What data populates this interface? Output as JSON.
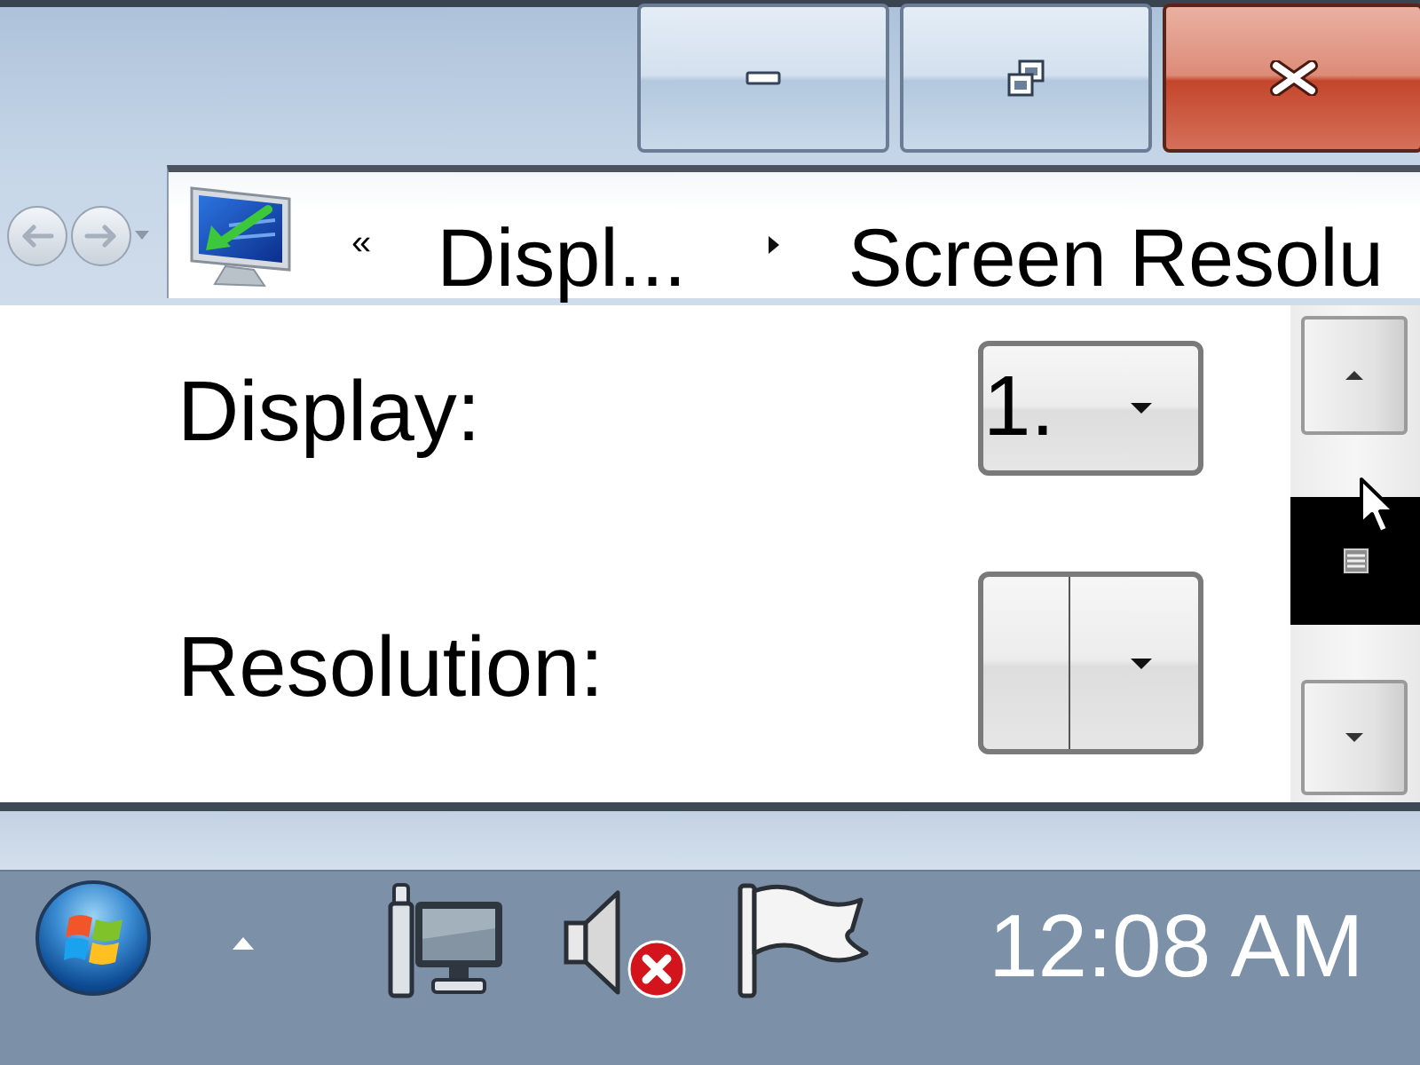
{
  "address_bar": {
    "overflow": "«",
    "breadcrumbs": [
      "Displ...",
      "Screen Resolu"
    ]
  },
  "settings": [
    {
      "label": "Display:",
      "kind": "dropdown",
      "value": "1."
    },
    {
      "label": "Resolution:",
      "kind": "split-dropdown"
    }
  ],
  "taskbar": {
    "clock": "12:08 AM"
  }
}
